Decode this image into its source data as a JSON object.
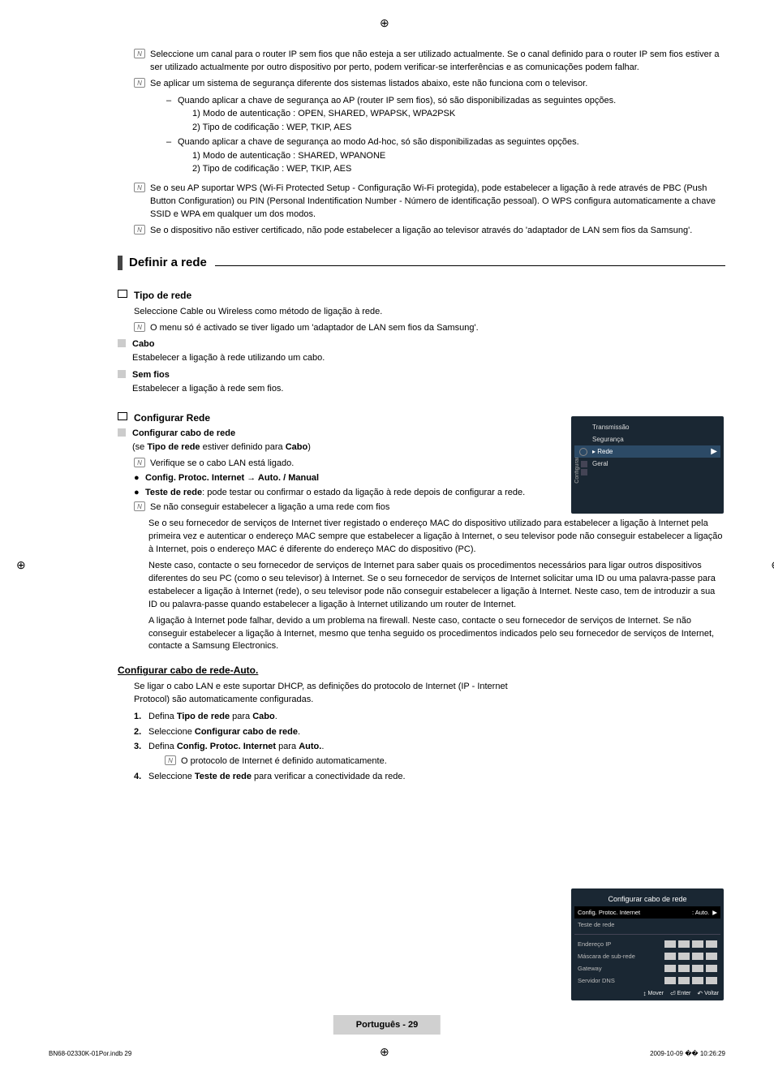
{
  "notes": {
    "n1": "Seleccione um canal para o router IP sem fios que não esteja a ser utilizado actualmente. Se o canal definido para o router IP sem fios estiver a ser utilizado actualmente por outro dispositivo por perto, podem verificar-se interferências e as comunicações podem falhar.",
    "n2": "Se aplicar um sistema de segurança diferente dos sistemas listados abaixo, este não funciona com o televisor.",
    "n2_s1": "Quando aplicar a chave de segurança ao AP (router IP sem fios), só são disponibilizadas as seguintes opções.",
    "n2_s1a": "1) Modo de autenticação : OPEN, SHARED, WPAPSK, WPA2PSK",
    "n2_s1b": "2) Tipo de codificação : WEP, TKIP, AES",
    "n2_s2": "Quando aplicar a chave de segurança ao modo Ad-hoc, só são disponibilizadas as seguintes opções.",
    "n2_s2a": "1) Modo de autenticação : SHARED, WPANONE",
    "n2_s2b": "2) Tipo de codificação : WEP, TKIP, AES",
    "n3": "Se o seu AP suportar WPS (Wi-Fi Protected Setup - Configuração Wi-Fi protegida), pode estabelecer a ligação à rede através de PBC (Push Button Configuration) ou PIN (Personal Indentification Number - Número de identificação pessoal). O WPS configura automaticamente a chave SSID e WPA em qualquer um dos modos.",
    "n4": "Se o dispositivo não estiver certificado, não pode estabelecer a ligação ao televisor através do 'adaptador de LAN sem fios da Samsung'."
  },
  "section": {
    "title": "Definir a rede"
  },
  "tipo": {
    "head": "Tipo de rede",
    "desc": "Seleccione Cable ou Wireless como método de ligação à rede.",
    "note": "O menu só é activado se tiver ligado um 'adaptador de LAN sem fios da Samsung'.",
    "cabo_h": "Cabo",
    "cabo_d": "Estabelecer a ligação à rede utilizando um cabo.",
    "semfios_h": "Sem fios",
    "semfios_d": "Estabelecer a ligação à rede sem fios."
  },
  "config": {
    "head": "Configurar Rede",
    "cabo_h": "Configurar cabo de rede",
    "cabo_sub_pre": "(se ",
    "cabo_sub_b1": "Tipo de rede",
    "cabo_sub_mid": " estiver definido para ",
    "cabo_sub_b2": "Cabo",
    "cabo_sub_end": ")",
    "verify": "Verifique se o cabo LAN está ligado.",
    "proto": "Config. Protoc. Internet → Auto. / Manual",
    "teste_b": "Teste de rede",
    "teste_rest": ": pode testar ou confirmar o estado da ligação à rede depois de configurar a rede.",
    "cannot": "Se não conseguir estabelecer a ligação a uma rede com fios",
    "p1": "Se o seu fornecedor de serviços de Internet tiver registado o endereço MAC do dispositivo utilizado para estabelecer a ligação à Internet pela primeira vez e autenticar o endereço MAC sempre que estabelecer a ligação à Internet, o seu televisor pode não conseguir estabelecer a ligação à Internet, pois o endereço MAC é diferente do endereço MAC do dispositivo (PC).",
    "p2": "Neste caso, contacte o seu fornecedor de serviços de Internet para saber quais os procedimentos necessários para ligar outros dispositivos diferentes do seu PC (como o seu televisor) à Internet. Se o seu fornecedor de serviços de Internet solicitar uma ID ou uma palavra-passe para estabelecer a ligação à Internet (rede), o seu televisor pode não conseguir estabelecer a ligação à Internet. Neste caso, tem de introduzir a sua ID ou palavra-passe quando estabelecer a ligação à Internet utilizando um router de Internet.",
    "p3": "A ligação à Internet pode falhar, devido a um problema na firewall. Neste caso, contacte o seu fornecedor de serviços de Internet. Se não conseguir estabelecer a ligação à Internet, mesmo que tenha seguido os procedimentos indicados pelo seu fornecedor de serviços de Internet, contacte a Samsung Electronics."
  },
  "auto": {
    "head": "Configurar cabo de rede-Auto.",
    "intro": "Se ligar o cabo LAN e este suportar DHCP, as definições do protocolo de Internet (IP - Internet Protocol) são automaticamente configuradas.",
    "s1_pre": "Defina ",
    "s1_b1": "Tipo de rede",
    "s1_mid": " para ",
    "s1_b2": "Cabo",
    "s1_end": ".",
    "s2_pre": "Seleccione ",
    "s2_b": "Configurar cabo de rede",
    "s2_end": ".",
    "s3_pre": "Defina ",
    "s3_b1": "Config. Protoc. Internet",
    "s3_mid": " para ",
    "s3_b2": "Auto.",
    "s3_end": ".",
    "s3_note": "O protocolo de Internet é definido automaticamente.",
    "s4_pre": "Seleccione ",
    "s4_b": "Teste de rede",
    "s4_end": " para verificar a conectividade da rede."
  },
  "osd1": {
    "side": "Configurar",
    "r0": "Transmissão",
    "r1": "Segurança",
    "r2": "Rede",
    "r3": "Geral"
  },
  "osd2": {
    "title": "Configurar cabo de rede",
    "row1l": "Config. Protoc. Internet",
    "row1r": "Auto.",
    "row2": "Teste de rede",
    "ip": "Endereço IP",
    "mask": "Máscara de sub-rede",
    "gw": "Gateway",
    "dns": "Servidor DNS",
    "mover_icon": "↕",
    "mover": "Mover",
    "enter_icon": "⏎",
    "enter": "Enter",
    "voltar_icon": "↶",
    "voltar": "Voltar"
  },
  "footer": {
    "lang_page": "Português - 29",
    "left": "BN68-02330K-01Por.indb   29",
    "right": "2009-10-09   �� 10:26:29"
  },
  "glyph": {
    "note": "N",
    "dash": "–",
    "dot": "●",
    "arrow": "▶"
  }
}
